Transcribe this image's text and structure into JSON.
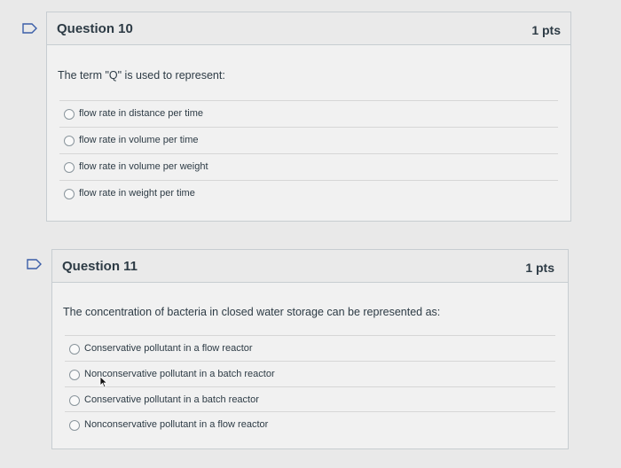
{
  "questions": [
    {
      "title": "Question 10",
      "points": "1 pts",
      "text": "The term \"Q\" is used to represent:",
      "options": [
        "flow rate in distance per time",
        "flow rate in volume per time",
        "flow rate in volume per weight",
        "flow rate in weight per time"
      ]
    },
    {
      "title": "Question 11",
      "points": "1 pts",
      "text": "The concentration of bacteria in closed water storage can be represented as:",
      "options": [
        "Conservative pollutant in a flow reactor",
        "Nonconservative pollutant in a batch reactor",
        "Conservative pollutant in a batch reactor",
        "Nonconservative pollutant in a flow reactor"
      ]
    }
  ],
  "icons": {
    "flag": "flag-outline-icon",
    "radio": "radio-unselected-icon",
    "cursor": "mouse-pointer-icon"
  },
  "colors": {
    "background": "#e9e9e9",
    "card": "#f1f1f1",
    "border": "#c7cdd1",
    "text": "#2d3b45"
  }
}
